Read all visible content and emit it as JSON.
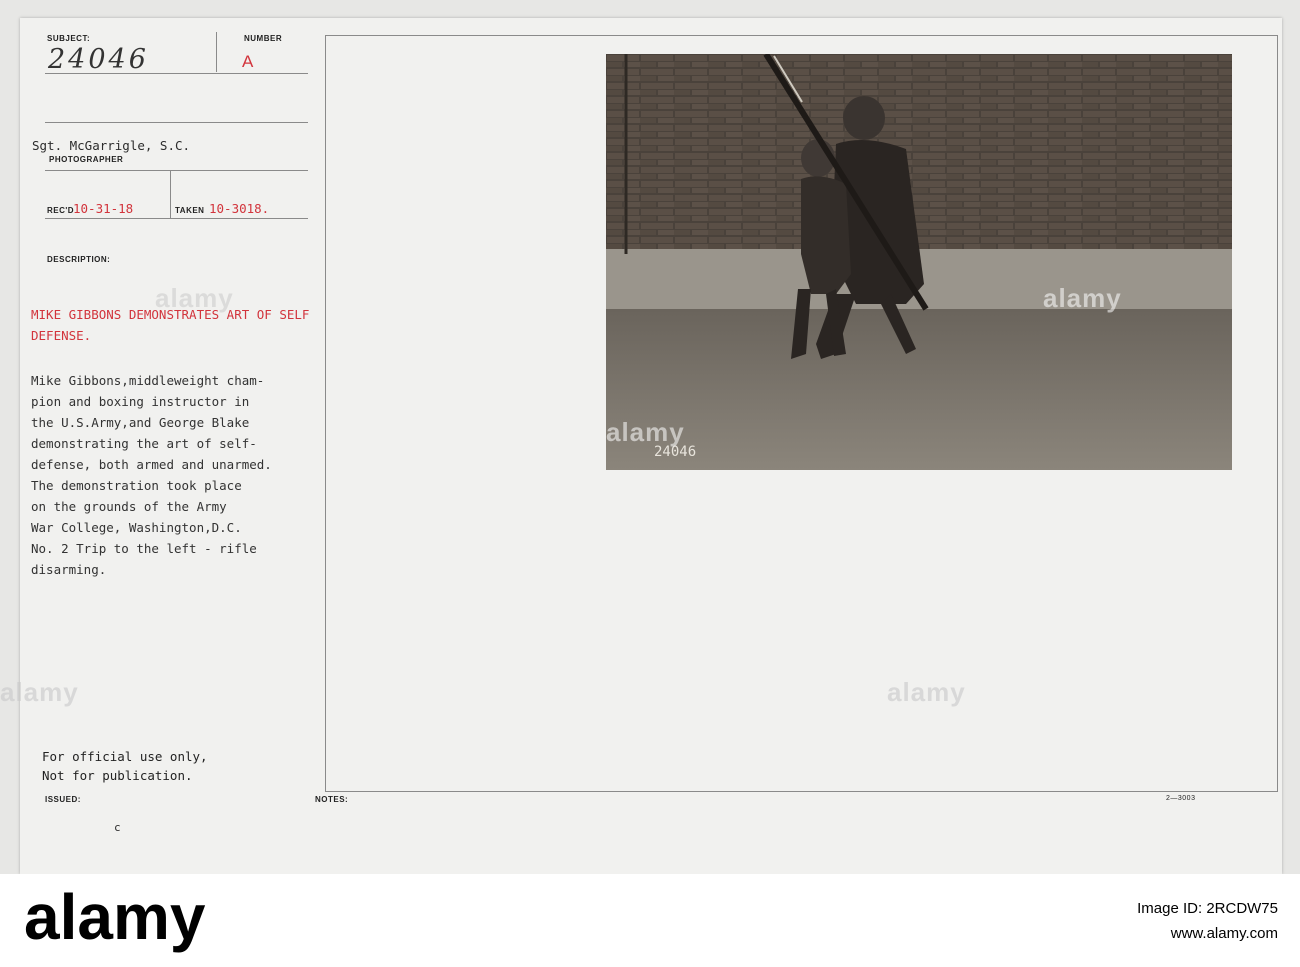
{
  "card": {
    "subject_label": "SUBJECT:",
    "subject_number": "24046",
    "number_label": "NUMBER",
    "number_value": "A",
    "photographer_name": "Sgt. McGarrigle, S.C.",
    "photographer_label": "PHOTOGRAPHER",
    "recd_label": "REC'D",
    "recd_value": "10-31-18",
    "taken_label": "TAKEN",
    "taken_value": "10-3018.",
    "description_label": "DESCRIPTION:",
    "description_title": "MIKE GIBBONS DEMONSTRATES ART OF SELF DEFENSE.",
    "description_body": "Mike Gibbons,middleweight cham-\npion and boxing instructor in\nthe U.S.Army,and George Blake\ndemonstrating the art of self-\ndefense, both armed and unarmed.\nThe demonstration took place\non the grounds of the Army\nWar College, Washington,D.C.\nNo. 2 Trip to the left - rifle\ndisarming.",
    "official_note": "For official use only,\nNot for publication.",
    "issued_label": "ISSUED:",
    "issued_mark": "c",
    "notes_label": "NOTES:",
    "form_code": "2—3003",
    "photo_stamp": "24046"
  },
  "watermark": {
    "text": "alamy",
    "image_id_label": "Image ID:",
    "image_id": "2RCDW75",
    "site": "www.alamy.com"
  },
  "colors": {
    "typed_red": "#d2343c",
    "card_bg": "#f1f1ef"
  }
}
